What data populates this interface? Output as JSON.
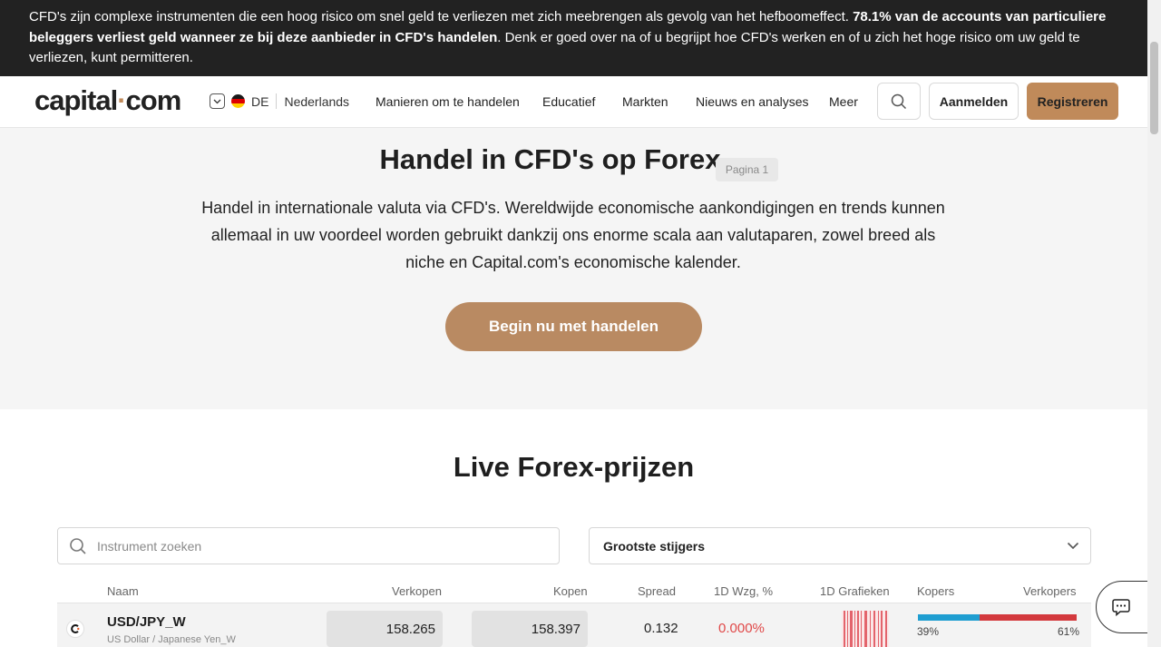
{
  "risk_banner": {
    "text_before": "CFD's zijn complexe instrumenten die een hoog risico om snel geld te verliezen met zich meebrengen als gevolg van het hefboomeffect. ",
    "text_bold": "78.1% van de accounts van particuliere beleggers verliest geld wanneer ze bij deze aanbieder in CFD's handelen",
    "text_after": ". Denk er goed over na of u begrijpt hoe CFD's werken en of u zich het hoge risico om uw geld te verliezen, kunt permitteren."
  },
  "header": {
    "logo_left": "capital",
    "logo_dot": "·",
    "logo_right": "com",
    "country_code": "DE",
    "language": "Nederlands",
    "nav": [
      "Manieren om te handelen",
      "Educatief",
      "Markten",
      "Nieuws en analyses",
      "Meer"
    ],
    "login_label": "Aanmelden",
    "register_label": "Registreren"
  },
  "hero": {
    "title": "Handel in CFD's op Forex",
    "page_badge": "Pagina 1",
    "description": "Handel in internationale valuta via CFD's. Wereldwijde economische aankondigingen en trends kunnen allemaal in uw voordeel worden gebruikt dankzij ons enorme scala aan valutaparen, zowel breed als niche en Capital.com's economische kalender.",
    "cta_label": "Begin nu met handelen"
  },
  "live_prices": {
    "title": "Live Forex-prijzen",
    "search_placeholder": "Instrument zoeken",
    "sort_selected": "Grootste stijgers",
    "columns": [
      "Naam",
      "Verkopen",
      "Kopen",
      "Spread",
      "1D Wzg, %",
      "1D Grafieken",
      "Kopers",
      "Verkopers"
    ],
    "rows": [
      {
        "symbol": "USD/JPY_W",
        "name": "US Dollar / Japanese Yen_W",
        "sell": "158.265",
        "buy": "158.397",
        "spread": "0.132",
        "change": "0.000%",
        "buyers_pct": "39%",
        "sellers_pct": "61%",
        "buyers_fraction": 0.39
      }
    ]
  },
  "colors": {
    "banner_bg": "#222222",
    "brand_accent": "#c08a5a",
    "cta_bg": "#b98a62",
    "hero_bg": "#f5f5f5",
    "negative": "#e04848",
    "buyers": "#1f9ed1",
    "sellers": "#d3393d"
  },
  "icons": {
    "search": "search-icon",
    "dropdown": "chevron-down-icon",
    "chat": "chat-icon",
    "coin": "capital-coin-icon"
  }
}
